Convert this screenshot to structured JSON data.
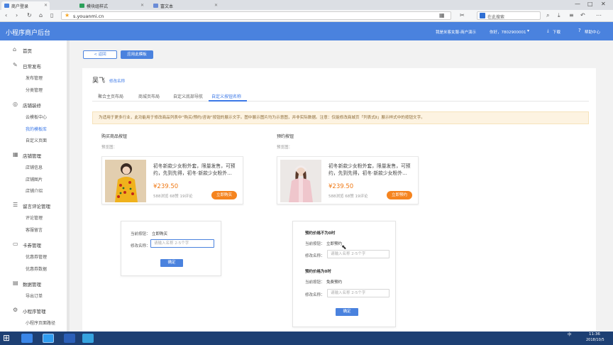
{
  "browser": {
    "tabs": [
      {
        "label": "商户登录",
        "color": "#4a82de"
      },
      {
        "label": "模块组样式",
        "color": "#2aa05a"
      },
      {
        "label": "富文本",
        "color": "#6a8bd6"
      }
    ],
    "url": "s.youanmi.cn",
    "search_placeholder": "在此搜索",
    "window_controls": [
      "—",
      "□",
      "✕"
    ]
  },
  "header": {
    "title": "小程序商户后台",
    "shop": "我是米客女服-商户演示",
    "user": "你好，7802900001",
    "download": "下载",
    "help": "帮助中心"
  },
  "sidebar": [
    {
      "icon": "⌂",
      "label": "首页",
      "items": []
    },
    {
      "icon": "✎",
      "label": "日常发布",
      "items": [
        {
          "label": "发布管理"
        },
        {
          "label": "分类管理"
        }
      ]
    },
    {
      "icon": "◎",
      "label": "店铺装修",
      "items": [
        {
          "label": "云模板中心"
        },
        {
          "label": "我的模板库",
          "active": true
        },
        {
          "label": "自定义页面"
        }
      ]
    },
    {
      "icon": "▦",
      "label": "店铺管理",
      "items": [
        {
          "label": "店铺信息"
        },
        {
          "label": "店铺图片"
        },
        {
          "label": "店铺介绍"
        }
      ]
    },
    {
      "icon": "☰",
      "label": "留言评论管理",
      "items": [
        {
          "label": "评论管理"
        },
        {
          "label": "客服留言"
        }
      ]
    },
    {
      "icon": "▭",
      "label": "卡券管理",
      "items": [
        {
          "label": "优惠券管理"
        },
        {
          "label": "优惠券数据"
        }
      ]
    },
    {
      "icon": "▤",
      "label": "数据管理",
      "items": [
        {
          "label": "导出订单"
        }
      ]
    },
    {
      "icon": "⚙",
      "label": "小程序管理",
      "items": [
        {
          "label": "小程序页面路径"
        }
      ]
    }
  ],
  "main": {
    "back_button": "< 返回",
    "apply_button": "应用此模板",
    "store_name": "吴飞",
    "rename_link": "修改名称",
    "tabs": [
      "聚合主页布局",
      "商城页布局",
      "自定义底部导航",
      "自定义按钮名称"
    ],
    "active_tab": 3,
    "notice": "为适用于更多行业，此功能用于修改商品列表中“购买/预约/咨询”按钮的展示文字。图中展示图片均为示意图，并非实际数据。注意：仅能修改商城页「列表式Ⅱ」展示样式中的按钮文字。",
    "buy_section": {
      "title": "购买商品按钮",
      "preview_label": "预览图：",
      "product": {
        "name": "初冬新款少女粉外套，限量发售，可预约，先到先得，初冬·新款少女粉外…",
        "price": "¥239.50",
        "stats": "588浏览 68赞 19评论",
        "button": "立即购买"
      },
      "form": {
        "current_label": "当前按钮：",
        "current_value": "立即购买",
        "edit_label": "修改名称：",
        "placeholder": "请输入名称 2-5个字",
        "ok": "确定"
      }
    },
    "reserve_section": {
      "title": "预约按钮",
      "preview_label": "预览图：",
      "product": {
        "name": "初冬新款少女粉外套，限量发售，可预约，先到先得，初冬·新款少女粉外…",
        "price": "¥239.50",
        "stats": "588浏览 68赞 19评论",
        "button": "立即预约"
      },
      "form": {
        "block1_title": "预约价格不为0时",
        "current_label": "当前按钮：",
        "current_value1": "立即预约",
        "edit_label": "修改名称：",
        "placeholder": "请输入名称 2-5个字",
        "block2_title": "预约价格为0时",
        "current_value2": "免费预约",
        "ok": "确定"
      }
    }
  },
  "taskbar": {
    "time": "11:36",
    "date": "2018/10/5",
    "ime": "中"
  },
  "colors": {
    "brand": "#4a82de",
    "accent": "#f5841f",
    "notice_bg": "#fdf3e1"
  }
}
